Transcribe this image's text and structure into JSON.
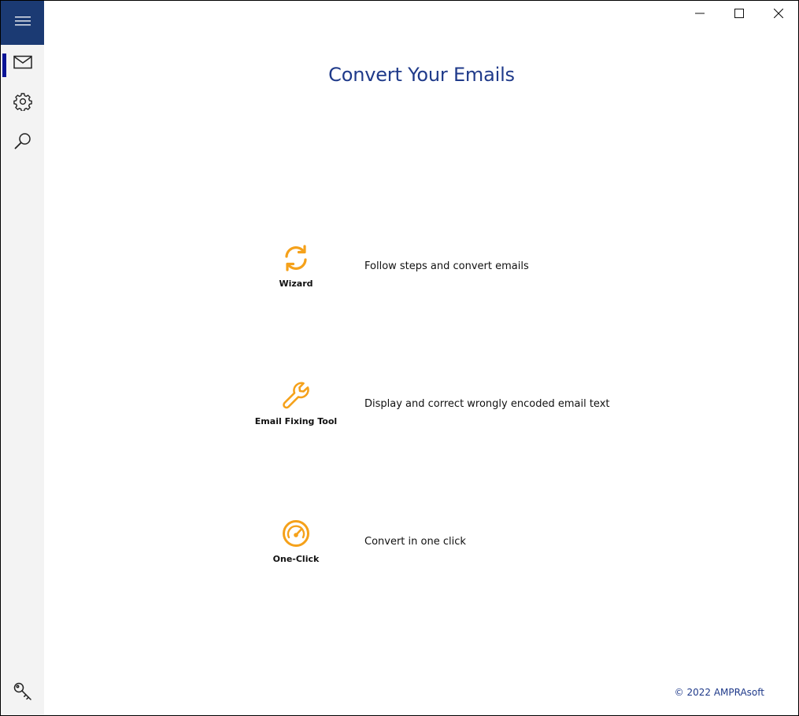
{
  "window": {
    "controls": {
      "minimize_icon": "minimize-icon",
      "maximize_icon": "maximize-icon",
      "close_icon": "close-icon"
    }
  },
  "sidebar": {
    "menu_icon": "hamburger-icon",
    "items": [
      {
        "id": "convert",
        "icon": "mail-icon",
        "active": true
      },
      {
        "id": "settings",
        "icon": "gear-icon",
        "active": false
      },
      {
        "id": "search",
        "icon": "search-icon",
        "active": false
      }
    ],
    "bottom_icon": "key-icon"
  },
  "main": {
    "title": "Convert Your Emails",
    "actions": [
      {
        "label": "Wizard",
        "icon": "sync-icon",
        "description": "Follow steps and convert emails"
      },
      {
        "label": "Email Fixing Tool",
        "icon": "wrench-icon",
        "description": "Display and correct wrongly encoded email text"
      },
      {
        "label": "One-Click",
        "icon": "speedometer-icon",
        "description": "Convert in one click"
      }
    ]
  },
  "footer": {
    "copyright": "© 2022 AMPRAsoft"
  },
  "colors": {
    "accent_orange": "#f5a11a",
    "title_blue": "#1f3a8a",
    "menu_bg": "#1b3a73",
    "active_indicator": "#0a1496",
    "sidebar_bg": "#f3f3f3"
  }
}
